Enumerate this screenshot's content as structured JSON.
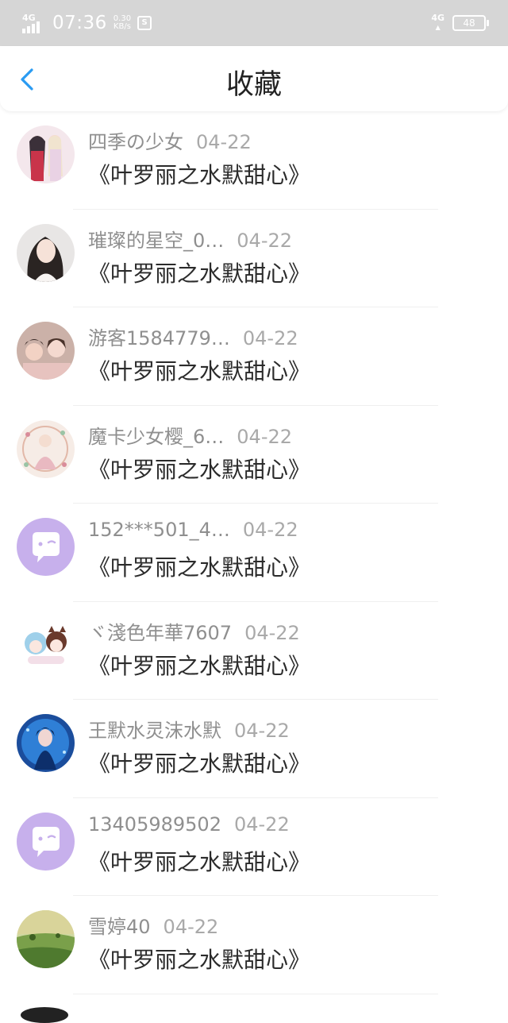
{
  "status_bar": {
    "network": "4G",
    "time": "07:36",
    "speed_value": "0.30",
    "speed_unit": "KB/s",
    "right_network": "4G",
    "battery": "48"
  },
  "header": {
    "title": "收藏",
    "back_icon": "chevron-left-icon"
  },
  "favorites": [
    {
      "username": "四季の少女",
      "date": "04-22",
      "title": "《叶罗丽之水默甜心》",
      "avatar": "anime-couple"
    },
    {
      "username": "璀璨的星空_0…",
      "date": "04-22",
      "title": "《叶罗丽之水默甜心》",
      "avatar": "girl-photo"
    },
    {
      "username": "游客1584779…",
      "date": "04-22",
      "title": "《叶罗丽之水默甜心》",
      "avatar": "friends-photo"
    },
    {
      "username": "魔卡少女樱_6…",
      "date": "04-22",
      "title": "《叶罗丽之水默甜心》",
      "avatar": "sakura-art"
    },
    {
      "username": "152***501_4…",
      "date": "04-22",
      "title": "《叶罗丽之水默甜心》",
      "avatar": "default-chat"
    },
    {
      "username": "ヾ淺色年華7607",
      "date": "04-22",
      "title": "《叶罗丽之水默甜心》",
      "avatar": "chibi-pair"
    },
    {
      "username": "王默水灵沫水默",
      "date": "04-22",
      "title": "《叶罗丽之水默甜心》",
      "avatar": "blue-fairy"
    },
    {
      "username": "13405989502",
      "date": "04-22",
      "title": "《叶罗丽之水默甜心》",
      "avatar": "default-chat"
    },
    {
      "username": "雪婷40",
      "date": "04-22",
      "title": "《叶罗丽之水默甜心》",
      "avatar": "landscape"
    }
  ]
}
